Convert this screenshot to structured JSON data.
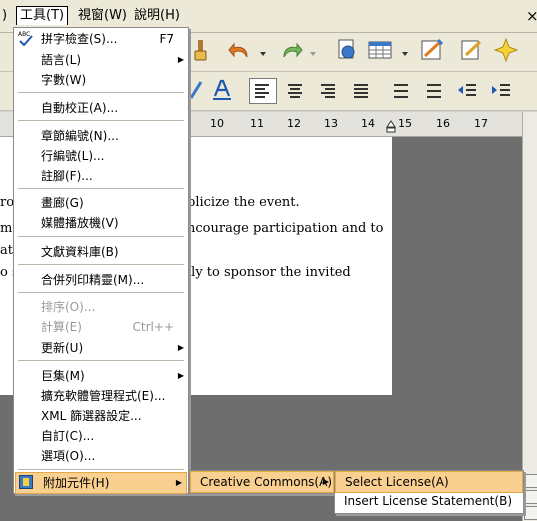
{
  "menubar": {
    "partial_label": ")",
    "tools": "工具(T)",
    "window": "視窗(W)",
    "help": "說明(H)",
    "close_glyph": "×"
  },
  "ruler": {
    "ticks": [
      "10",
      "11",
      "12",
      "13",
      "14",
      "15",
      "16",
      "17"
    ]
  },
  "document": {
    "lines": [
      "ror",
      "me",
      "at",
      "o s",
      "blicize the event.",
      "ncourage participation and to",
      "lly to sponsor the invited"
    ]
  },
  "tools_menu": {
    "items": [
      {
        "label": "拼字檢查(S)...",
        "shortcut": "F7"
      },
      {
        "label": "語言(L)"
      },
      {
        "label": "字數(W)"
      },
      {
        "label": "自動校正(A)..."
      },
      {
        "label": "章節編號(N)..."
      },
      {
        "label": "行編號(L)..."
      },
      {
        "label": "註腳(F)..."
      },
      {
        "label": "畫廊(G)"
      },
      {
        "label": "媒體播放機(V)"
      },
      {
        "label": "文獻資料庫(B)"
      },
      {
        "label": "合併列印精靈(M)..."
      },
      {
        "label": "排序(O)..."
      },
      {
        "label": "計算(E)",
        "shortcut": "Ctrl++"
      },
      {
        "label": "更新(U)"
      },
      {
        "label": "巨集(M)"
      },
      {
        "label": "擴充軟體管理程式(E)..."
      },
      {
        "label": "XML 篩選器設定..."
      },
      {
        "label": "自訂(C)..."
      },
      {
        "label": "選項(O)..."
      },
      {
        "label": "附加元件(H)"
      }
    ]
  },
  "addons_menu": {
    "items": [
      {
        "label": "Creative Commons(A)"
      }
    ]
  },
  "cc_menu": {
    "items": [
      {
        "label": "Select License(A)"
      },
      {
        "label": "Insert License Statement(B)"
      }
    ]
  },
  "colors": {
    "highlight": "#f9d08f",
    "highlight_border": "#e3a947",
    "menubar": "#ece9d8"
  }
}
